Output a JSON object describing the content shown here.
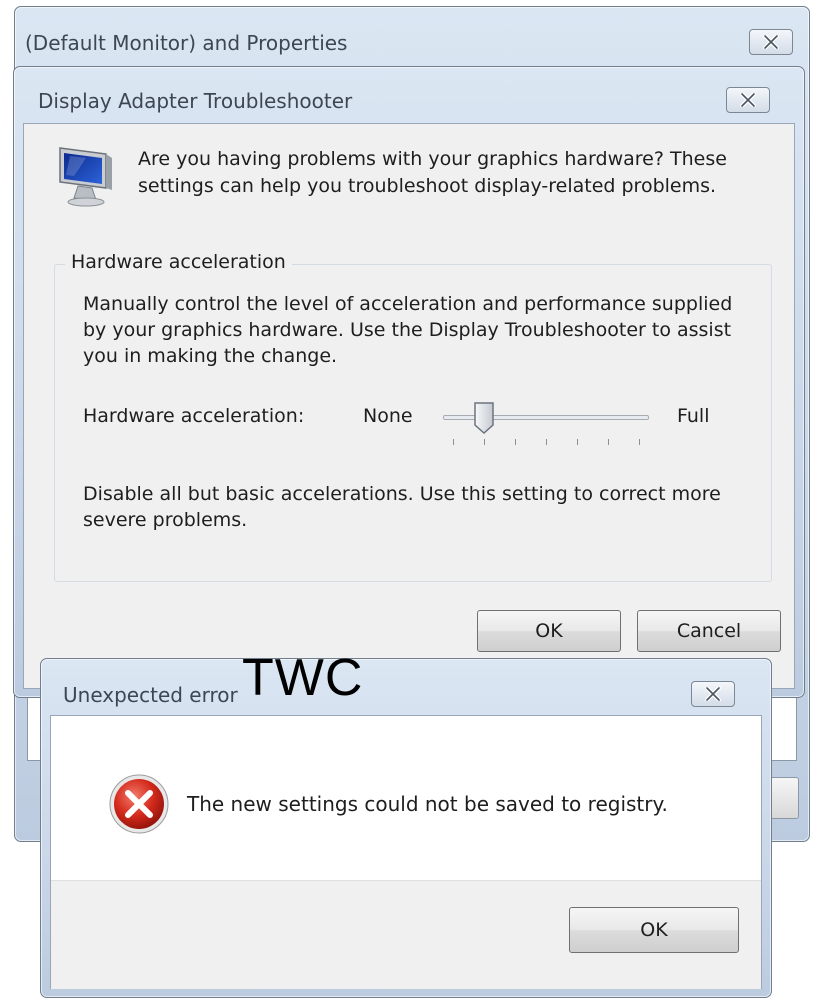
{
  "properties_window": {
    "title": "(Default Monitor) and  Properties"
  },
  "troubleshooter": {
    "title": "Display Adapter Troubleshooter",
    "intro": "Are you having problems with your graphics hardware? These settings can help you troubleshoot display-related problems.",
    "group": {
      "legend": "Hardware acceleration",
      "description": "Manually control the level of acceleration and performance supplied by your graphics hardware. Use the Display Troubleshooter to assist you in making the change.",
      "slider_label": "Hardware acceleration:",
      "min_label": "None",
      "max_label": "Full",
      "slider_level": 1,
      "slider_steps": 6,
      "note": "Disable all but basic accelerations. Use this setting to correct more severe problems."
    },
    "ok_label": "OK",
    "cancel_label": "Cancel"
  },
  "error_dialog": {
    "title": "Unexpected error",
    "message": "The new settings could not be saved to registry.",
    "ok_label": "OK"
  },
  "watermark": "TWC",
  "icons": {
    "close": "close-icon",
    "monitor": "monitor-icon",
    "error": "error-icon"
  }
}
